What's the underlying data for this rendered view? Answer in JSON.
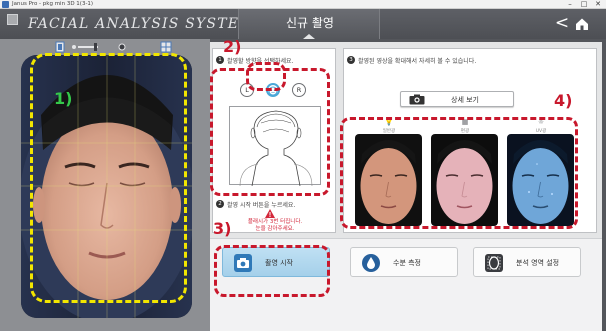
{
  "window": {
    "title": "Janus Pro - pkg min 3D 1(3-1)",
    "controls": [
      "–",
      "□",
      "✕"
    ]
  },
  "header": {
    "logo": "FACIAL ANALYSIS SYSTEM",
    "page_title": "신규 촬영",
    "back_icon": "chevron-left-icon",
    "home_icon": "home-icon"
  },
  "camera": {
    "toolbar": [
      "portrait-icon",
      "slider-icon",
      "grid-icon"
    ]
  },
  "select_panel": {
    "step": "1",
    "instruction": "촬영할 방향을 선택하세요.",
    "directions": [
      {
        "label": "L",
        "selected": false
      },
      {
        "label": "F",
        "selected": true
      },
      {
        "label": "R",
        "selected": false
      }
    ],
    "capture_step": "2",
    "capture_text": "촬영 시작 버튼을 누르세요.",
    "warning_line1": "플래시가 3번 터집니다.",
    "warning_line2": "눈을 감아주세요."
  },
  "result_panel": {
    "step": "3",
    "instruction": "촬영된 영상을 확대해서 자세히 볼 수 있습니다.",
    "detail_button": "상세 보기",
    "modes": [
      {
        "icon": "bulb-icon",
        "label": "일반광"
      },
      {
        "icon": "polarize-icon",
        "label": "편광"
      },
      {
        "icon": "uv-icon",
        "label": "UV광"
      }
    ]
  },
  "actions": {
    "start": "촬영 시작",
    "moisture": "수분 측정",
    "area": "분석 영역 설정"
  },
  "annotations": {
    "labels": [
      "1)",
      "2)",
      "3)",
      "4)"
    ],
    "colors": {
      "red": "#c8182c",
      "yellow": "#f2e600",
      "green": "#34c84a"
    }
  }
}
